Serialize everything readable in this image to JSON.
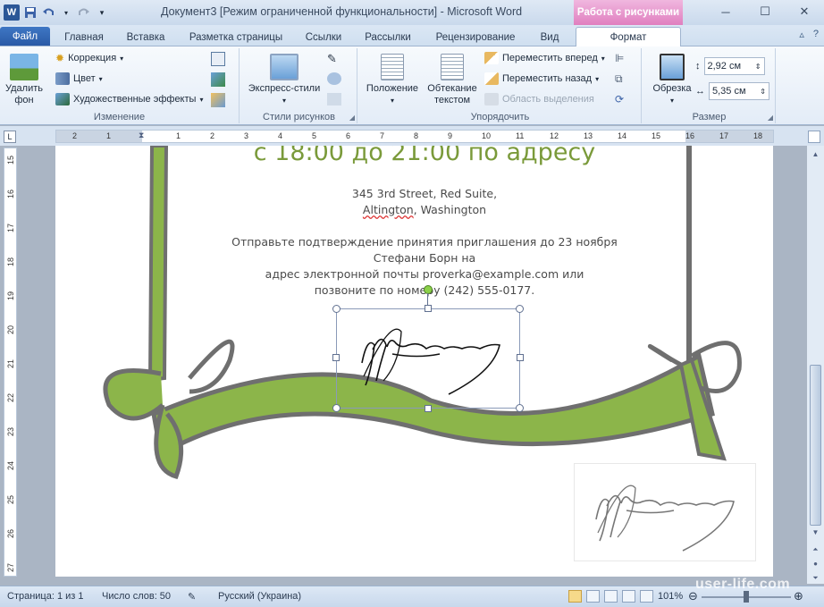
{
  "window": {
    "title": "Документ3 [Режим ограниченной функциональности]  -  Microsoft Word",
    "context_tab_group": "Работа с рисунками",
    "app_icon": "W",
    "controls": [
      "minimize",
      "maximize",
      "close"
    ]
  },
  "tabs": [
    {
      "label": "Файл"
    },
    {
      "label": "Главная"
    },
    {
      "label": "Вставка"
    },
    {
      "label": "Разметка страницы"
    },
    {
      "label": "Ссылки"
    },
    {
      "label": "Рассылки"
    },
    {
      "label": "Рецензирование"
    },
    {
      "label": "Вид"
    },
    {
      "label": "Формат"
    }
  ],
  "ribbon": {
    "remove_bg": {
      "line1": "Удалить",
      "line2": "фон"
    },
    "correction": "Коррекция",
    "color": "Цвет",
    "art_effects": "Художественные эффекты",
    "group_change": "Изменение",
    "express_styles": "Экспресс-стили",
    "group_styles": "Стили рисунков",
    "position": "Положение",
    "wrap": {
      "line1": "Обтекание",
      "line2": "текстом"
    },
    "bring_forward": "Переместить вперед",
    "send_backward": "Переместить назад",
    "selection_pane": "Область выделения",
    "group_arrange": "Упорядочить",
    "crop": "Обрезка",
    "height": "2,92 см",
    "width": "5,35 см",
    "group_size": "Размер"
  },
  "ruler": {
    "corner": "L",
    "h_numbers": [
      "2",
      "1",
      "1",
      "2",
      "3",
      "4",
      "5",
      "6",
      "7",
      "8",
      "9",
      "10",
      "11",
      "12",
      "13",
      "14",
      "15",
      "16",
      "17",
      "18"
    ],
    "v_numbers": [
      "15",
      "16",
      "17",
      "18",
      "19",
      "20",
      "21",
      "22",
      "23",
      "24",
      "25",
      "26",
      "27"
    ]
  },
  "document": {
    "headline": "с 18:00 до 21:00 по адресу",
    "address_line1": "345 3rd Street, Red Suite,",
    "address_city": "Altington",
    "address_state": ", Washington",
    "rsvp_line1": "Отправьте подтверждение принятия приглашения до 23 ноября",
    "rsvp_line2": "Стефани Борн на",
    "rsvp_line3": "адрес электронной почты proverka@example.com или",
    "rsvp_line4": "позвоните по номеру (242) 555-0177."
  },
  "status": {
    "page": "Страница: 1 из 1",
    "words": "Число слов: 50",
    "language": "Русский (Украина)",
    "zoom": "101%",
    "watermark": "user-life.com"
  },
  "colors": {
    "accent_green": "#8cb54a",
    "frame_gray": "#6f6f6f",
    "file_tab": "#2a5aa6",
    "context_pink": "#e07fbf"
  }
}
